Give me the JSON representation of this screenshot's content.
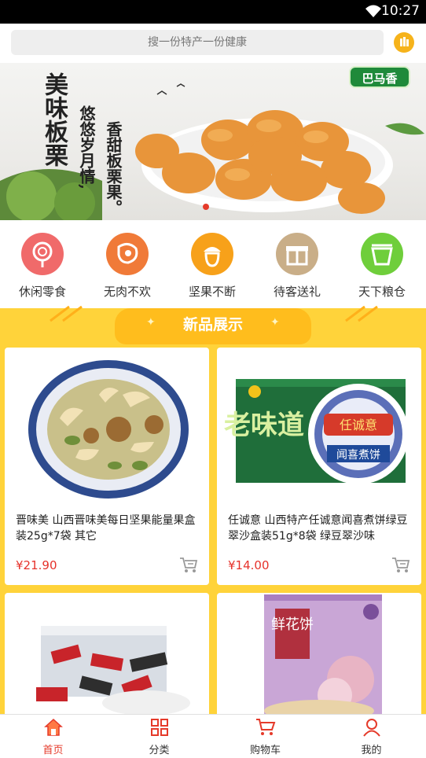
{
  "status_bar": {
    "time": "10:27"
  },
  "search": {
    "placeholder": "搜一份特产一份健康"
  },
  "banner": {
    "title": "美味板栗",
    "line1": "悠悠岁月情,",
    "line2": "香甜板栗果。",
    "brand": "巴马香"
  },
  "categories": [
    {
      "label": "休闲零食",
      "icon": "lollipop-icon",
      "color": "#f06a6a"
    },
    {
      "label": "无肉不欢",
      "icon": "meat-icon",
      "color": "#f07a38"
    },
    {
      "label": "坚果不断",
      "icon": "acorn-icon",
      "color": "#f7a11a"
    },
    {
      "label": "待客送礼",
      "icon": "gift-icon",
      "color": "#c9ae88"
    },
    {
      "label": "天下粮仓",
      "icon": "grain-icon",
      "color": "#6fce3b"
    }
  ],
  "section": {
    "title": "新品展示"
  },
  "products": [
    {
      "name": "晋味美 山西晋味美每日坚果能量果盒装25g*7袋 其它",
      "price": "¥21.90"
    },
    {
      "name": "任诚意 山西特产任诚意闻喜煮饼绿豆翠沙盒装51g*8袋 绿豆翠沙味",
      "price": "¥14.00"
    },
    {
      "name": "",
      "price": ""
    },
    {
      "name": "",
      "price": ""
    }
  ],
  "product_images": {
    "box_text_1": "老味道",
    "box_text_2": "闻喜煮饼",
    "box_brand": "任诚意",
    "bag_text": "鲜花饼"
  },
  "tabs": [
    {
      "label": "首页",
      "icon": "home-icon",
      "active": true
    },
    {
      "label": "分类",
      "icon": "grid-icon",
      "active": false
    },
    {
      "label": "购物车",
      "icon": "cart-icon",
      "active": false
    },
    {
      "label": "我的",
      "icon": "user-icon",
      "active": false
    }
  ],
  "colors": {
    "accent": "#e53a2a",
    "section_bg": "#ffd33a",
    "price": "#e6322b"
  }
}
